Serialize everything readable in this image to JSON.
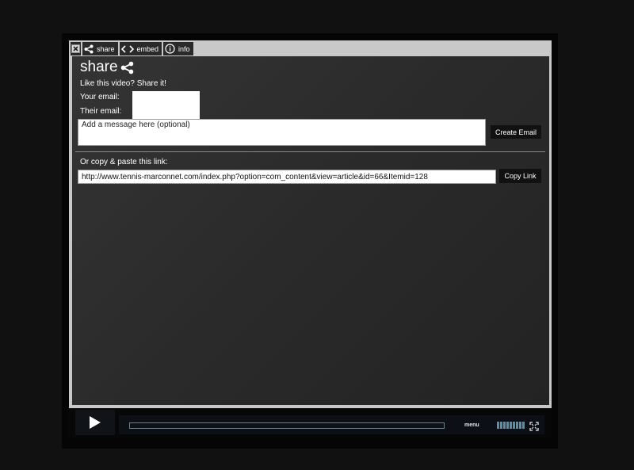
{
  "tabs": [
    {
      "label": "share",
      "icon": "share-icon"
    },
    {
      "label": "embed",
      "icon": "code-icon"
    },
    {
      "label": "info",
      "icon": "info-icon"
    }
  ],
  "share": {
    "title": "share",
    "subtitle": "Like this video? Share it!",
    "your_email_label": "Your email:",
    "their_email_label": "Their email:",
    "your_email_value": "",
    "their_email_value": "",
    "message_placeholder": "Add a message here (optional)",
    "create_email_label": "Create Email",
    "copy_prompt": "Or copy & paste this link:",
    "link_value": "http://www.tennis-marconnet.com/index.php?option=com_content&view=article&id=66&Itemid=128",
    "copy_link_label": "Copy Link"
  },
  "controls": {
    "menu_label": "menu",
    "progress": 0,
    "volume_fraction": 1.0
  },
  "colors": {
    "panel": "#2c2c2c",
    "frame": "#c8c8c8",
    "volume": "#5a8fa6"
  }
}
